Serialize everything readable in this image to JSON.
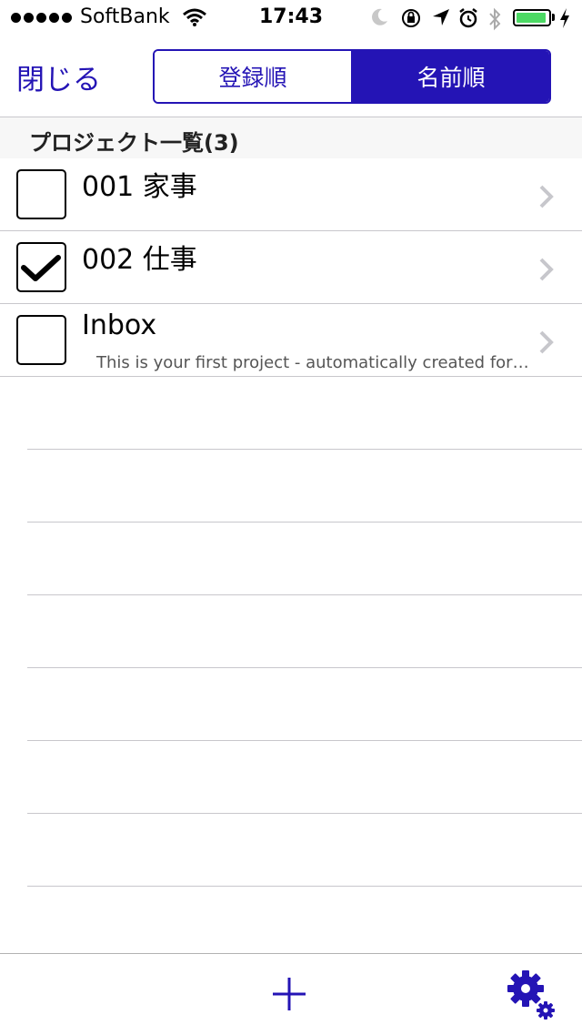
{
  "status_bar": {
    "carrier": "SoftBank",
    "time": "17:43",
    "battery_level": 0.95,
    "icons": [
      "signal-dots",
      "wifi-icon",
      "moon-icon",
      "rotation-lock-icon",
      "location-arrow-icon",
      "alarm-icon",
      "bluetooth-icon",
      "battery-icon",
      "charging-bolt-icon"
    ]
  },
  "nav": {
    "close_label": "閉じる",
    "segments": [
      {
        "label": "登録順",
        "selected": false
      },
      {
        "label": "名前順",
        "selected": true
      }
    ]
  },
  "section": {
    "title": "プロジェクト一覧(3)"
  },
  "projects": [
    {
      "title": "001 家事",
      "subtitle": "",
      "checked": false
    },
    {
      "title": "002 仕事",
      "subtitle": "",
      "checked": true
    },
    {
      "title": "Inbox",
      "subtitle": "This is your first project - automatically created for…",
      "checked": false
    }
  ],
  "toolbar": {
    "icons": [
      "plus-icon",
      "settings-gears-icon"
    ]
  },
  "colors": {
    "accent": "#2414b5",
    "separator": "#c8c7cc",
    "battery": "#4cd964"
  }
}
